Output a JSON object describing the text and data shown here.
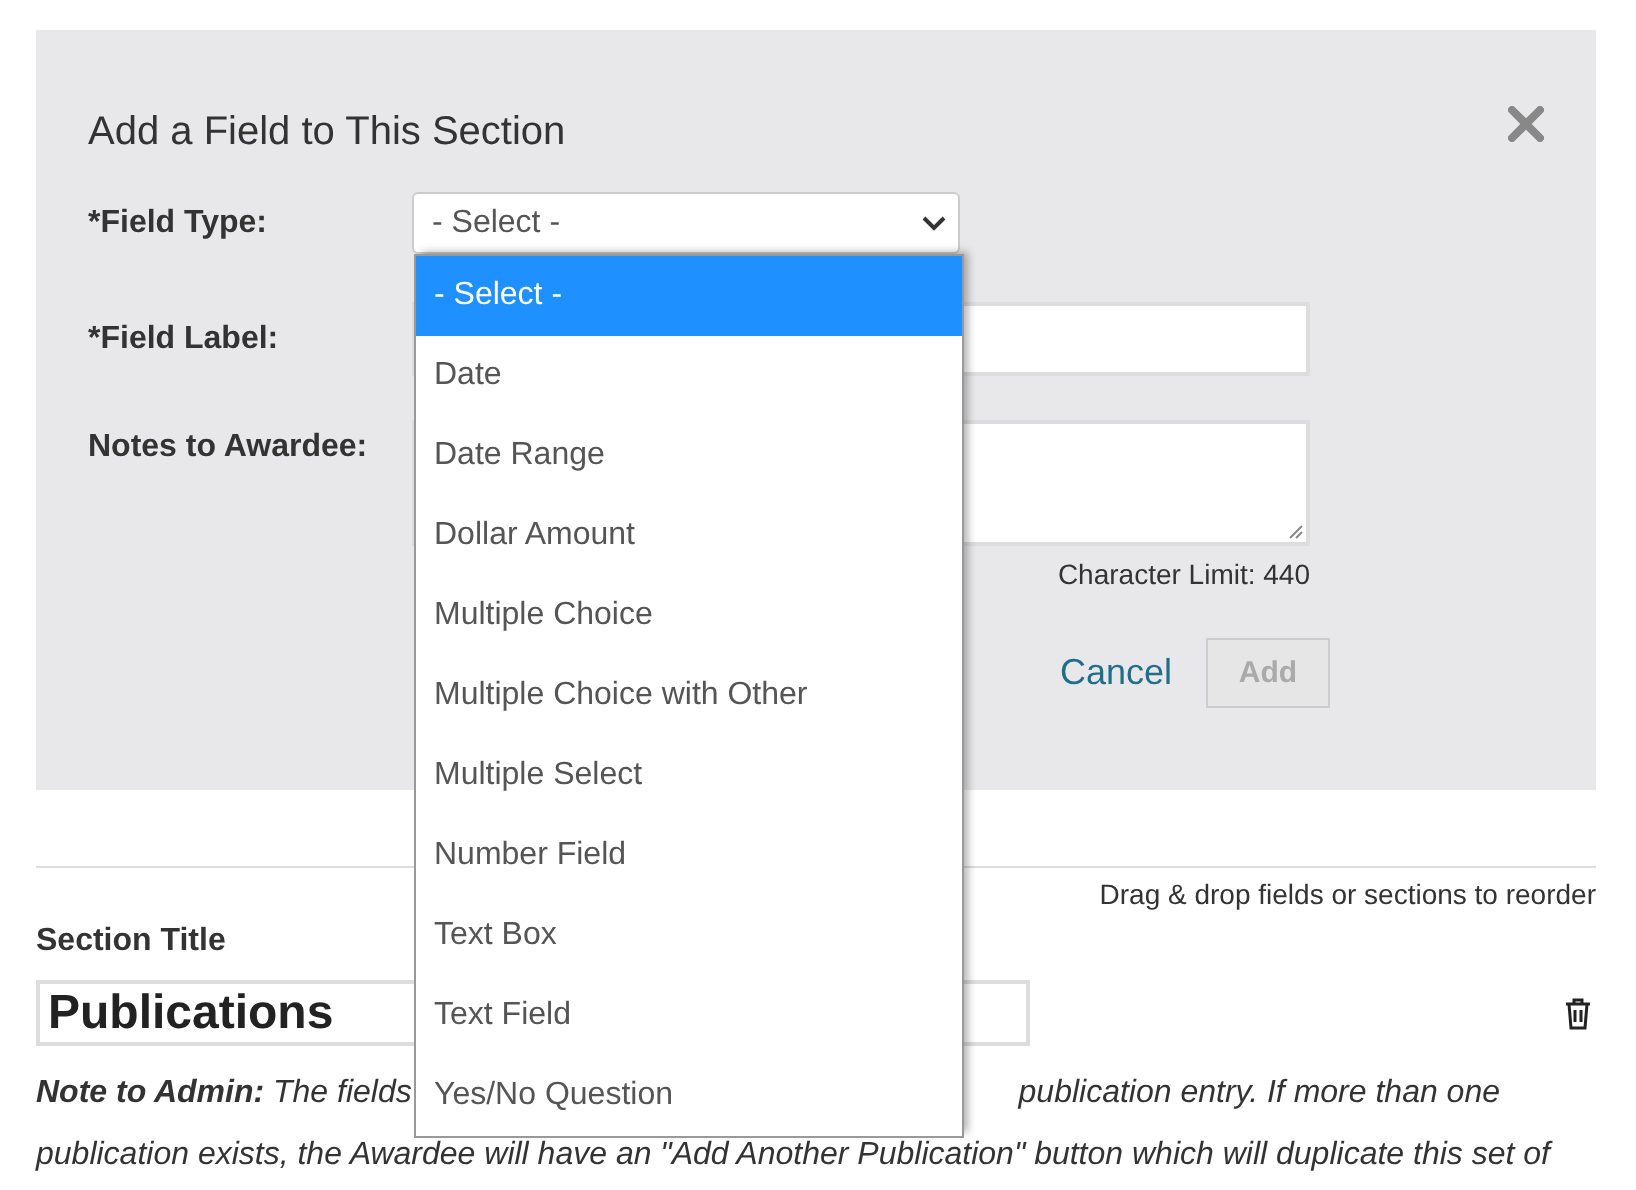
{
  "dialog": {
    "title": "Add a Field to This Section",
    "field_type": {
      "label": "*Field Type:",
      "value": "- Select -",
      "expanded": true,
      "options": [
        {
          "label": "- Select -",
          "selected": true
        },
        {
          "label": "Date",
          "selected": false
        },
        {
          "label": "Date Range",
          "selected": false
        },
        {
          "label": "Dollar Amount",
          "selected": false
        },
        {
          "label": "Multiple Choice",
          "selected": false
        },
        {
          "label": "Multiple Choice with Other",
          "selected": false
        },
        {
          "label": "Multiple Select",
          "selected": false
        },
        {
          "label": "Number Field",
          "selected": false
        },
        {
          "label": "Text Box",
          "selected": false
        },
        {
          "label": "Text Field",
          "selected": false
        },
        {
          "label": "Yes/No Question",
          "selected": false
        }
      ]
    },
    "field_label": {
      "label": "*Field Label:"
    },
    "notes": {
      "label": "Notes to Awardee:",
      "character_limit": "Character Limit: 440"
    },
    "cancel": "Cancel",
    "add": {
      "label": "Add",
      "disabled": true
    }
  },
  "reorder_hint": "Drag & drop fields or sections to reorder",
  "section": {
    "label": "Section Title",
    "value": "Publications",
    "note_lines": [
      {
        "left": "**Note to Admin:** The fields",
        "right": "publication entry. If more than one"
      },
      {
        "left": "publication exists, the Awardee will have an \"Add Another Publication\" button which will duplicate this set of"
      }
    ]
  }
}
